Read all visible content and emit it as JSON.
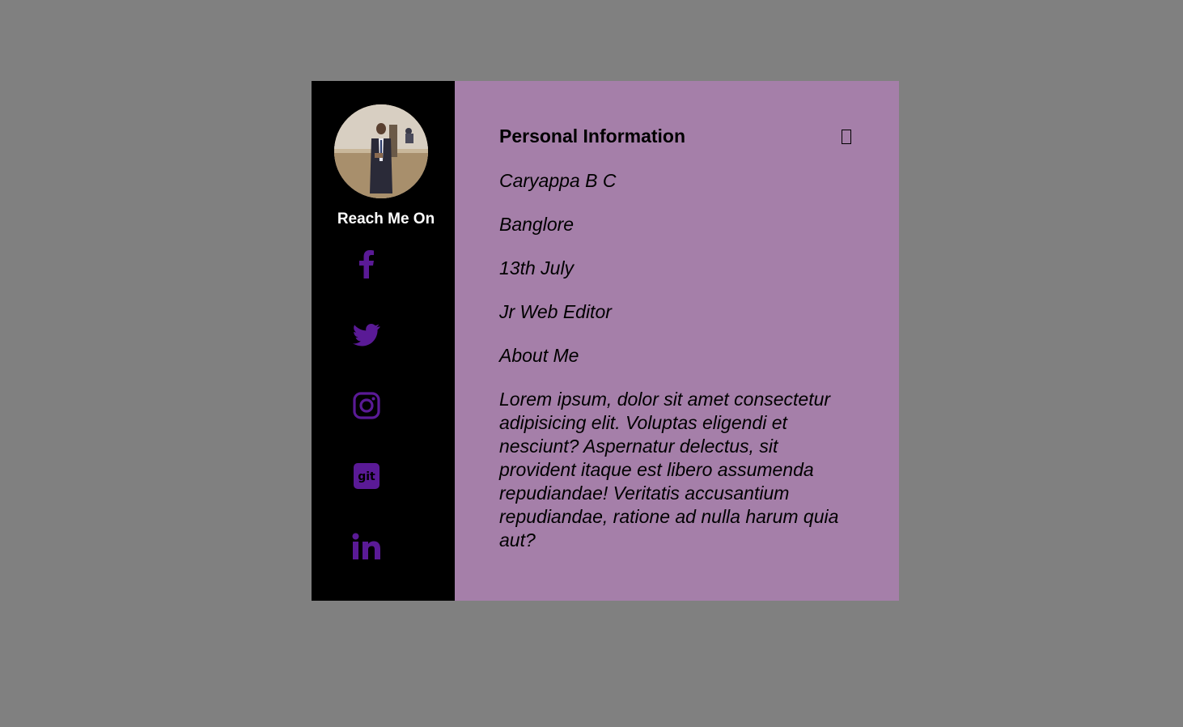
{
  "sidebar": {
    "reach_label": "Reach Me On",
    "social_icons": [
      "facebook-icon",
      "twitter-icon",
      "instagram-icon",
      "git-icon",
      "linkedin-icon"
    ],
    "icon_color": "#5a1a96"
  },
  "main": {
    "heading": "Personal Information",
    "name": "Caryappa B C",
    "location": "Banglore",
    "birthday": "13th July",
    "role": "Jr Web Editor",
    "about_label": "About Me",
    "about_text": "Lorem ipsum, dolor sit amet consectetur adipisicing elit. Voluptas eligendi et nesciunt? Aspernatur delectus, sit provident itaque est libero assumenda repudiandae! Veritatis accusantium repudiandae, ratione ad nulla harum quia aut?"
  },
  "colors": {
    "page_bg": "#808080",
    "sidebar_bg": "#000000",
    "panel_bg": "#a57fa9",
    "accent": "#5a1a96"
  }
}
